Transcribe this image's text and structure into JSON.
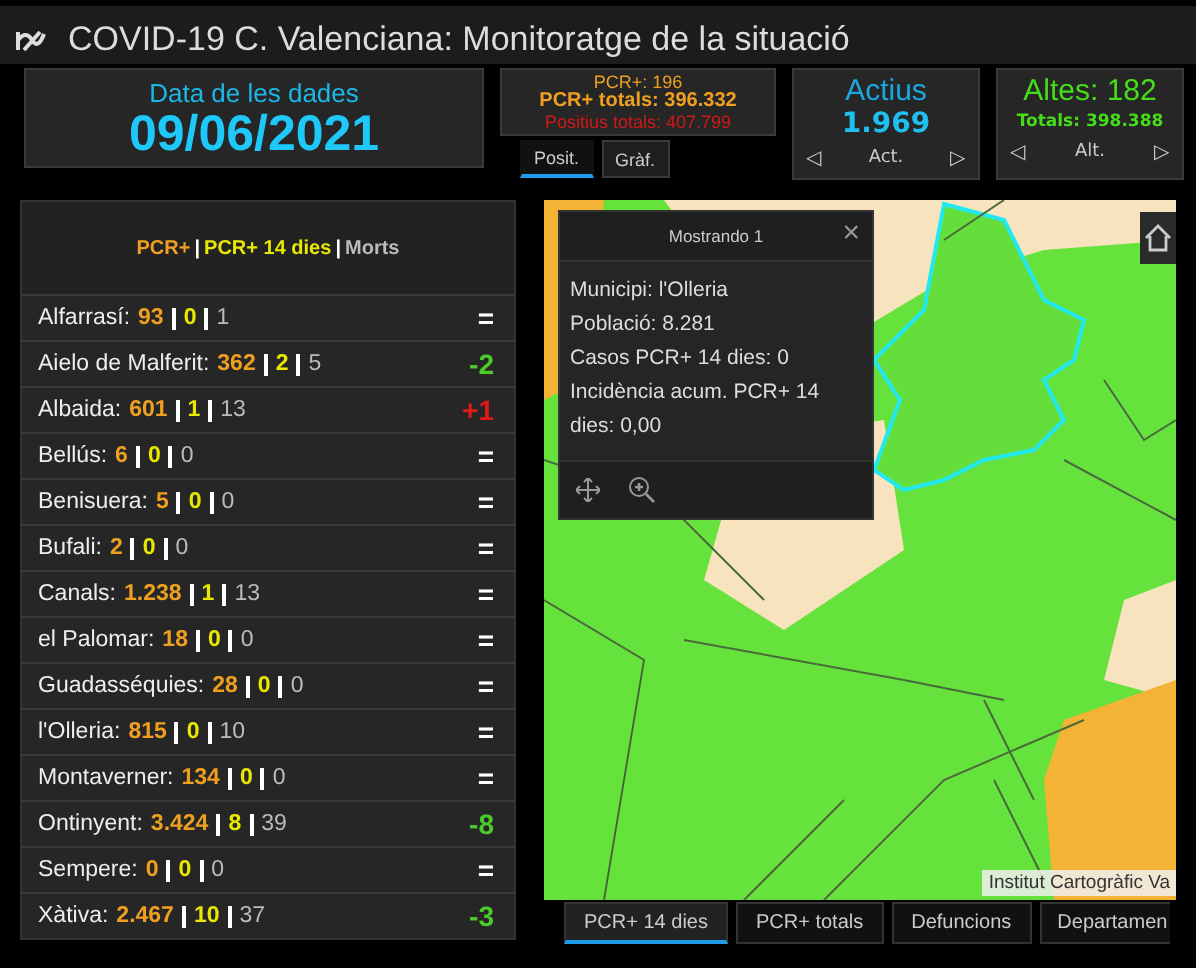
{
  "window": {
    "title": "COVID-19 C. Valenciana: Monitoratge de la situació"
  },
  "date_card": {
    "label": "Data de les dades",
    "value": "09/06/2021"
  },
  "pcr_card": {
    "lines": [
      {
        "kind": "pcr",
        "text": "PCR+: 196"
      },
      {
        "kind": "total",
        "text": "PCR+ totals: 396.332"
      },
      {
        "kind": "positive",
        "text": "Positius totals: 407.799"
      }
    ],
    "tabs": [
      {
        "label": "Posit.",
        "selected": true
      },
      {
        "label": "Gràf.",
        "selected": false
      }
    ]
  },
  "active_card": {
    "title": "Actius",
    "value": "1.969",
    "nav_label": "Act.",
    "prev": "◁",
    "next": "▷"
  },
  "discharged_card": {
    "title": "Altes: 182",
    "total": "Totals: 398.388",
    "nav_label": "Alt.",
    "prev": "◁",
    "next": "▷"
  },
  "list": {
    "legend": [
      {
        "kind": "pcr",
        "text": "PCR+"
      },
      {
        "kind": "sep",
        "text": "|"
      },
      {
        "kind": "d14",
        "text": "PCR+ 14 dies"
      },
      {
        "kind": "sep",
        "text": "|"
      },
      {
        "kind": "deaths",
        "text": "Morts"
      }
    ],
    "rows": [
      {
        "name": "Alfarrasí:",
        "pcr": "93",
        "d14": "0",
        "deaths": "1",
        "color": "#ffffff",
        "change": "="
      },
      {
        "name": "Aielo de Malferit:",
        "pcr": "362",
        "d14": "2",
        "deaths": "5",
        "color": "#4ccc2c",
        "change": "-2"
      },
      {
        "name": "Albaida:",
        "pcr": "601",
        "d14": "1",
        "deaths": "13",
        "color": "#e01818",
        "change": "+1"
      },
      {
        "name": "Bellús:",
        "pcr": "6",
        "d14": "0",
        "deaths": "0",
        "color": "#ffffff",
        "change": "="
      },
      {
        "name": "Benisuera:",
        "pcr": "5",
        "d14": "0",
        "deaths": "0",
        "color": "#ffffff",
        "change": "="
      },
      {
        "name": "Bufali:",
        "pcr": "2",
        "d14": "0",
        "deaths": "0",
        "color": "#ffffff",
        "change": "="
      },
      {
        "name": "Canals:",
        "pcr": "1.238",
        "d14": "1",
        "deaths": "13",
        "color": "#ffffff",
        "change": "="
      },
      {
        "name": "el Palomar:",
        "pcr": "18",
        "d14": "0",
        "deaths": "0",
        "color": "#ffffff",
        "change": "="
      },
      {
        "name": "Guadasséquies:",
        "pcr": "28",
        "d14": "0",
        "deaths": "0",
        "color": "#ffffff",
        "change": "="
      },
      {
        "name": "l'Olleria:",
        "pcr": "815",
        "d14": "0",
        "deaths": "10",
        "color": "#ffffff",
        "change": "="
      },
      {
        "name": "Montaverner:",
        "pcr": "134",
        "d14": "0",
        "deaths": "0",
        "color": "#ffffff",
        "change": "="
      },
      {
        "name": "Ontinyent:",
        "pcr": "3.424",
        "d14": "8",
        "deaths": "39",
        "color": "#4ccc2c",
        "change": "-8"
      },
      {
        "name": "Sempere:",
        "pcr": "0",
        "d14": "0",
        "deaths": "0",
        "color": "#ffffff",
        "change": "="
      },
      {
        "name": "Xàtiva:",
        "pcr": "2.467",
        "d14": "10",
        "deaths": "37",
        "color": "#4ccc2c",
        "change": "-3"
      }
    ]
  },
  "map": {
    "popup": {
      "title": "Mostrando 1",
      "close": "×",
      "lines": [
        "Municipi: l'Olleria",
        "Població: 8.281",
        "Casos PCR+ 14 dies: 0",
        "Incidència acum. PCR+ 14 dies: 0,00"
      ]
    },
    "attribution": "Institut Cartogràfic Va"
  },
  "map_tabs": [
    {
      "label": "PCR+ 14 dies",
      "selected": true
    },
    {
      "label": "PCR+ totals",
      "selected": false
    },
    {
      "label": "Defuncions",
      "selected": false
    },
    {
      "label": "Departamen",
      "selected": false
    }
  ]
}
